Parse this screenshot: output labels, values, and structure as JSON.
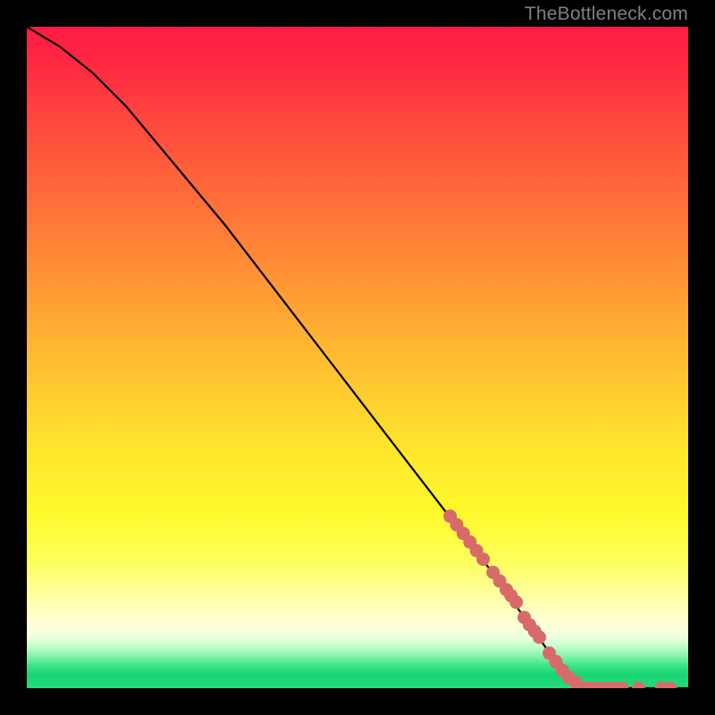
{
  "attribution": "TheBottleneck.com",
  "chart_data": {
    "type": "line",
    "title": "",
    "xlabel": "",
    "ylabel": "",
    "xlim": [
      0,
      100
    ],
    "ylim": [
      0,
      100
    ],
    "curve": [
      {
        "x": 0,
        "y": 100
      },
      {
        "x": 5,
        "y": 97
      },
      {
        "x": 10,
        "y": 93
      },
      {
        "x": 15,
        "y": 88
      },
      {
        "x": 20,
        "y": 82
      },
      {
        "x": 30,
        "y": 70
      },
      {
        "x": 40,
        "y": 57
      },
      {
        "x": 50,
        "y": 44
      },
      {
        "x": 60,
        "y": 31
      },
      {
        "x": 70,
        "y": 18
      },
      {
        "x": 75,
        "y": 11
      },
      {
        "x": 80,
        "y": 4
      },
      {
        "x": 83,
        "y": 1
      },
      {
        "x": 85,
        "y": 0
      },
      {
        "x": 100,
        "y": 0
      }
    ],
    "marker_color": "#d86a6a",
    "markers": [
      {
        "x": 64,
        "y": 26
      },
      {
        "x": 65,
        "y": 24.7
      },
      {
        "x": 66,
        "y": 23.4
      },
      {
        "x": 67,
        "y": 22.1
      },
      {
        "x": 68,
        "y": 20.8
      },
      {
        "x": 69,
        "y": 19.5
      },
      {
        "x": 70.5,
        "y": 17.5
      },
      {
        "x": 71.5,
        "y": 16.2
      },
      {
        "x": 72.5,
        "y": 14.9
      },
      {
        "x": 73.2,
        "y": 14
      },
      {
        "x": 74,
        "y": 13
      },
      {
        "x": 75.2,
        "y": 10.7
      },
      {
        "x": 76,
        "y": 9.6
      },
      {
        "x": 76.8,
        "y": 8.6
      },
      {
        "x": 77.5,
        "y": 7.7
      },
      {
        "x": 79,
        "y": 5.3
      },
      {
        "x": 80,
        "y": 4.0
      },
      {
        "x": 81,
        "y": 2.7
      },
      {
        "x": 82,
        "y": 1.6
      },
      {
        "x": 83,
        "y": 0.9
      },
      {
        "x": 84.5,
        "y": 0
      },
      {
        "x": 85.5,
        "y": 0
      },
      {
        "x": 86.5,
        "y": 0
      },
      {
        "x": 87.8,
        "y": 0
      },
      {
        "x": 89,
        "y": 0
      },
      {
        "x": 90,
        "y": 0
      },
      {
        "x": 92.5,
        "y": 0
      },
      {
        "x": 96,
        "y": 0
      },
      {
        "x": 97.3,
        "y": 0
      }
    ]
  }
}
